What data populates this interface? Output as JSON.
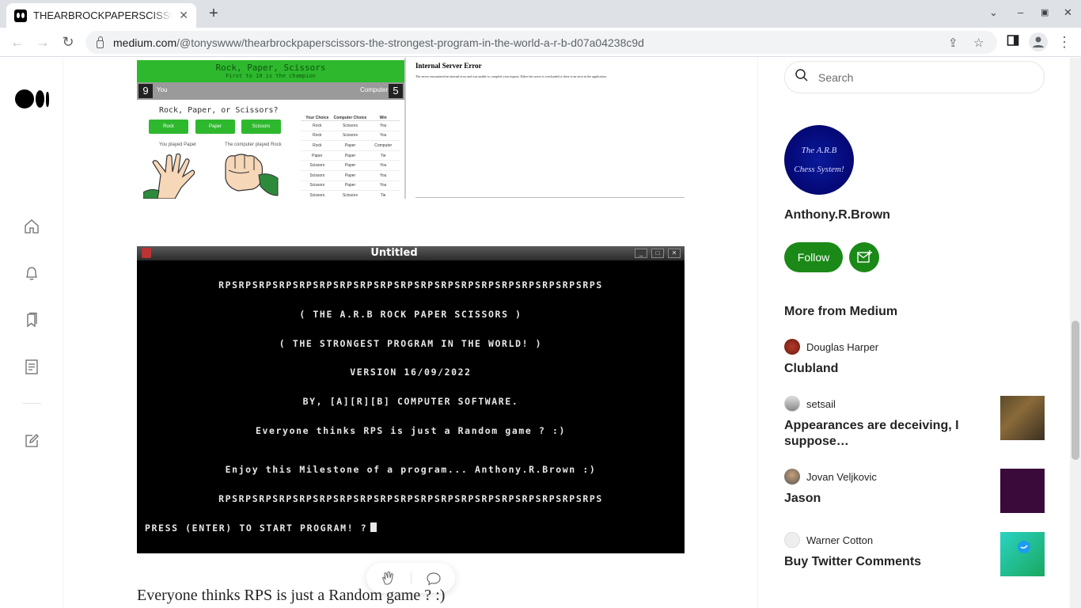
{
  "browser": {
    "tab_title": "THEARBROCKPAPERSCISSORS",
    "url_host": "medium.com",
    "url_path": "/@tonyswww/thearbrockpaperscissors-the-strongest-program-in-the-world-a-r-b-d07a04238c9d"
  },
  "rail": {
    "icons": [
      "medium-logo",
      "home-icon",
      "bell-icon",
      "bookmarks-icon",
      "stories-icon",
      "write-icon"
    ]
  },
  "screenshot1": {
    "header_title": "Rock, Paper, Scissors",
    "header_subtitle": "First to 10 is the champion",
    "player_score": "9",
    "player_label": "You",
    "computer_label": "Computer",
    "computer_score": "5",
    "question": "Rock, Paper, or Scissors?",
    "buttons": [
      "Rock",
      "Paper",
      "Scissors"
    ],
    "you_played": "You played Paper",
    "computer_played": "The computer played Rock",
    "table_headers": [
      "Your Choice",
      "Computer Choice",
      "Win"
    ],
    "table_rows": [
      [
        "Rock",
        "Scissors",
        "You"
      ],
      [
        "Rock",
        "Scissors",
        "You"
      ],
      [
        "Rock",
        "Paper",
        "Computer"
      ],
      [
        "Paper",
        "Paper",
        "Tie"
      ],
      [
        "Scissors",
        "Paper",
        "You"
      ],
      [
        "Scissors",
        "Paper",
        "You"
      ],
      [
        "Scissors",
        "Paper",
        "You"
      ],
      [
        "Scissors",
        "Scissors",
        "Tie"
      ]
    ],
    "error_title": "Internal Server Error",
    "error_text": "The server encountered an internal error and was unable to complete your request. Either the server is overloaded or there is an error in the application."
  },
  "console": {
    "window_title": "Untitled",
    "lines": [
      "RPSRPSRPSRPSRPSRPSRPSRPSRPSRPSRPSRPSRPSRPSRPSRPSRPSRPSRPS",
      "( THE A.R.B ROCK PAPER SCISSORS )",
      "( THE STRONGEST PROGRAM IN THE WORLD! )",
      "VERSION 16/09/2022",
      "BY, [A][R][B] COMPUTER SOFTWARE.",
      "Everyone thinks RPS is just a Random game ? :)",
      "Enjoy this Milestone of a program... Anthony.R.Brown :)",
      "RPSRPSRPSRPSRPSRPSRPSRPSRPSRPSRPSRPSRPSRPSRPSRPSRPSRPSRPS"
    ],
    "prompt": "PRESS (ENTER) TO START PROGRAM! ?"
  },
  "paragraph": "Everyone thinks RPS is just a Random game ? :)",
  "sidebar": {
    "search_placeholder": "Search",
    "avatar_line1": "The A.R.B",
    "avatar_line2": "Chess System!",
    "author_name": "Anthony.R.Brown",
    "follow_label": "Follow",
    "more_heading": "More from Medium",
    "recommendations": [
      {
        "author": "Douglas Harper",
        "title": "Clubland"
      },
      {
        "author": "setsail",
        "title": "Appearances are deceiving, I suppose…"
      },
      {
        "author": "Jovan Veljkovic",
        "title": "Jason"
      },
      {
        "author": "Warner Cotton",
        "title": "Buy Twitter Comments"
      }
    ]
  },
  "colors": {
    "accent_green": "#1a8917",
    "rps_green": "#2eb82e",
    "avatar_blue": "#050a7a"
  }
}
